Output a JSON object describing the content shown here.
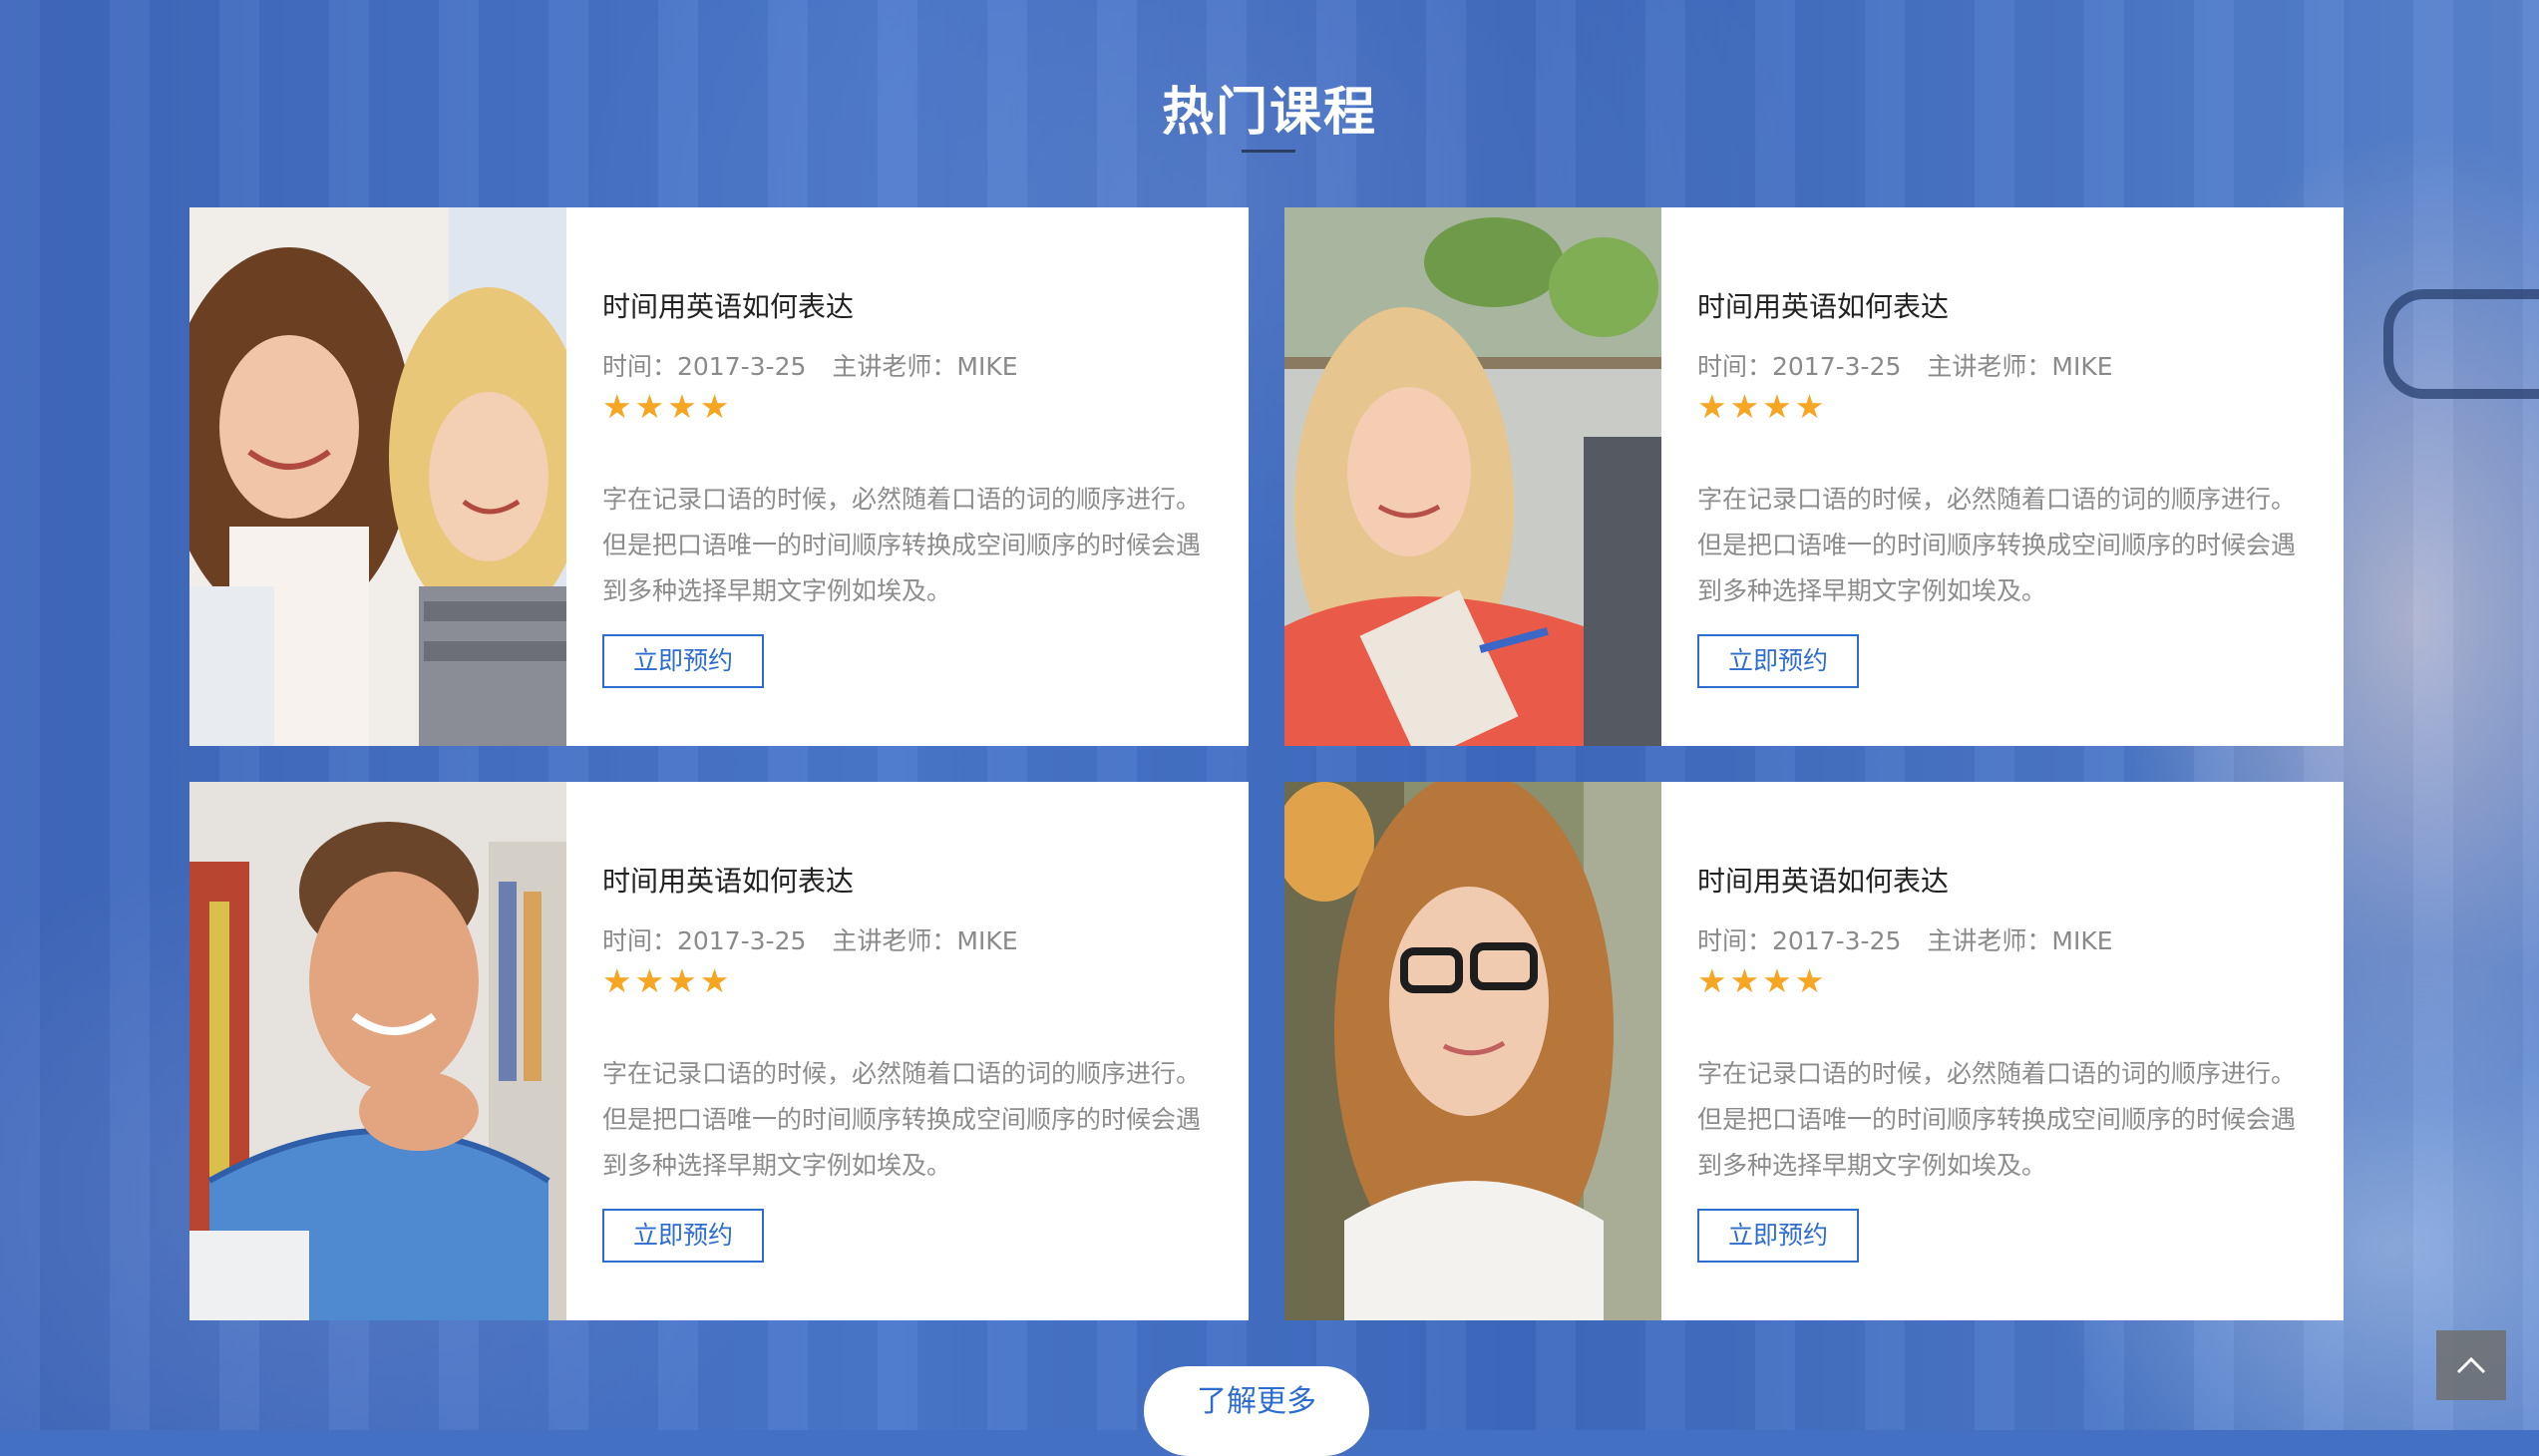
{
  "section": {
    "title": "热门课程"
  },
  "courses": [
    {
      "title": "时间用英语如何表达",
      "time": "时间：2017-3-25",
      "teacher": "主讲老师：MIKE",
      "stars": "★★★★",
      "rating": 4,
      "desc": "字在记录口语的时候，必然随着口语的词的顺序进行。但是把口语唯一的时间顺序转换成空间顺序的时候会遇到多种选择早期文字例如埃及。",
      "button": "立即预约",
      "photo": "two-female-students-laptop"
    },
    {
      "title": "时间用英语如何表达",
      "time": "时间：2017-3-25",
      "teacher": "主讲老师：MIKE",
      "stars": "★★★★",
      "rating": 4,
      "desc": "字在记录口语的时候，必然随着口语的词的顺序进行。但是把口语唯一的时间顺序转换成空间顺序的时候会遇到多种选择早期文字例如埃及。",
      "button": "立即预约",
      "photo": "woman-writing-notepad"
    },
    {
      "title": "时间用英语如何表达",
      "time": "时间：2017-3-25",
      "teacher": "主讲老师：MIKE",
      "stars": "★★★★",
      "rating": 4,
      "desc": "字在记录口语的时候，必然随着口语的词的顺序进行。但是把口语唯一的时间顺序转换成空间顺序的时候会遇到多种选择早期文字例如埃及。",
      "button": "立即预约",
      "photo": "smiling-man-plaid-shirt"
    },
    {
      "title": "时间用英语如何表达",
      "time": "时间：2017-3-25",
      "teacher": "主讲老师：MIKE",
      "stars": "★★★★",
      "rating": 4,
      "desc": "字在记录口语的时候，必然随着口语的词的顺序进行。但是把口语唯一的时间顺序转换成空间顺序的时候会遇到多种选择早期文字例如埃及。",
      "button": "立即预约",
      "photo": "woman-with-glasses"
    }
  ],
  "more_button": "了解更多",
  "back_to_top_icon": "chevron-up-icon",
  "colors": {
    "background": "#4470c4",
    "accent": "#2e6dd0",
    "star": "#f5a623"
  }
}
